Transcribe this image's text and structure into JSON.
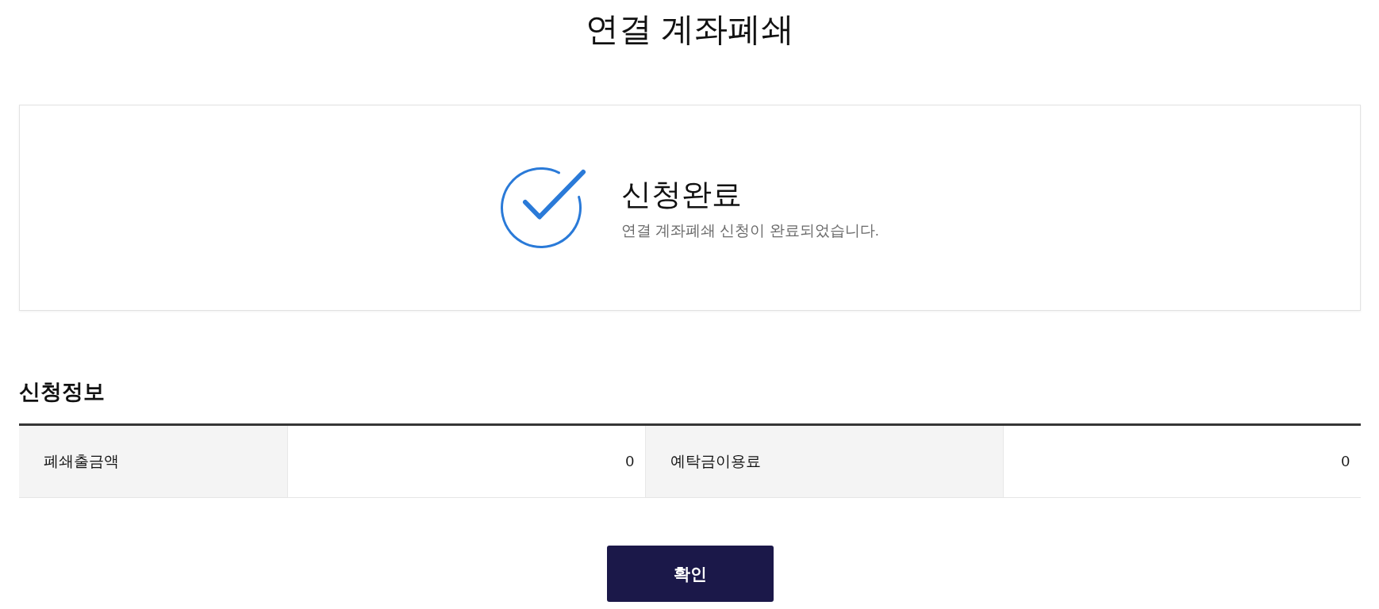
{
  "page_title": "연결 계좌폐쇄",
  "result": {
    "kind": "success",
    "title": "신청완료",
    "message": "연결 계좌폐쇄 신청이 완료되었습니다."
  },
  "info_section": {
    "heading": "신청정보",
    "fields": [
      {
        "label": "폐쇄출금액",
        "value": "0"
      },
      {
        "label": "예탁금이용료",
        "value": "0"
      }
    ]
  },
  "buttons": [
    {
      "label": "확인"
    }
  ]
}
